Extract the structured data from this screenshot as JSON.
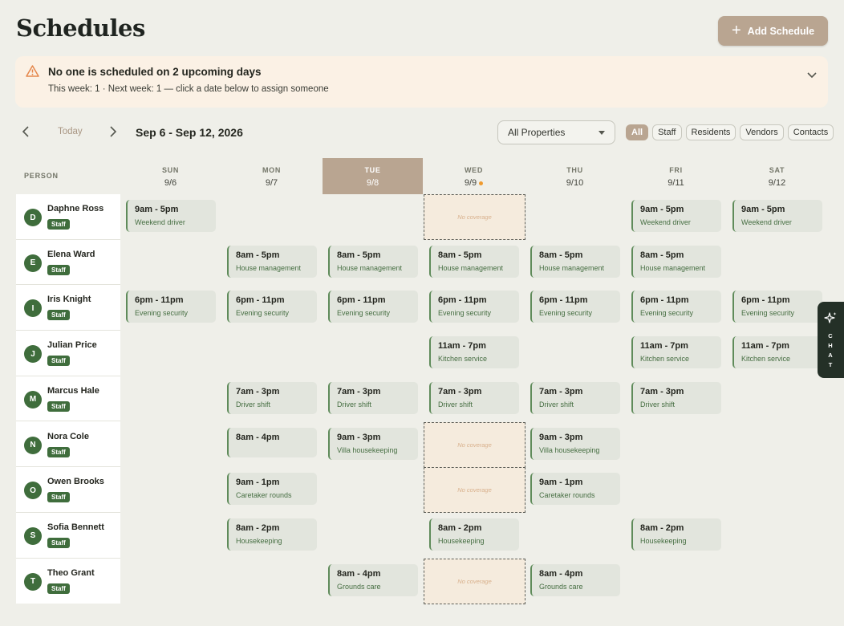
{
  "header": {
    "title": "Schedules",
    "add_button": "Add Schedule"
  },
  "alert": {
    "title": "No one is scheduled on 2 upcoming days",
    "subtitle": "This week: 1 · Next week: 1 — click a date below to assign someone"
  },
  "toolbar": {
    "today": "Today",
    "range": "Sep 6 - Sep 12, 2026",
    "property_select": "All Properties",
    "filters": [
      "All",
      "Staff",
      "Residents",
      "Vendors",
      "Contacts"
    ],
    "active_filter": "All"
  },
  "grid": {
    "person_header": "PERSON",
    "days": [
      {
        "name": "SUN",
        "date": "9/6"
      },
      {
        "name": "MON",
        "date": "9/7"
      },
      {
        "name": "TUE",
        "date": "9/8"
      },
      {
        "name": "WED",
        "date": "9/9"
      },
      {
        "name": "THU",
        "date": "9/10"
      },
      {
        "name": "FRI",
        "date": "9/11"
      },
      {
        "name": "SAT",
        "date": "9/12"
      }
    ],
    "today_index": 2,
    "no_coverage_label": "No coverage",
    "people": [
      {
        "name": "Daphne Ross",
        "initial": "D",
        "badge": "Staff",
        "shifts": [
          {
            "day": 0,
            "time": "9am - 5pm",
            "role": "Weekend driver"
          },
          {
            "day": 3,
            "nocov": true
          },
          {
            "day": 5,
            "time": "9am - 5pm",
            "role": "Weekend driver"
          },
          {
            "day": 6,
            "time": "9am - 5pm",
            "role": "Weekend driver"
          }
        ]
      },
      {
        "name": "Elena Ward",
        "initial": "E",
        "badge": "Staff",
        "shifts": [
          {
            "day": 1,
            "time": "8am - 5pm",
            "role": "House management"
          },
          {
            "day": 2,
            "time": "8am - 5pm",
            "role": "House management"
          },
          {
            "day": 3,
            "time": "8am - 5pm",
            "role": "House management"
          },
          {
            "day": 4,
            "time": "8am - 5pm",
            "role": "House management"
          },
          {
            "day": 5,
            "time": "8am - 5pm",
            "role": "House management"
          }
        ]
      },
      {
        "name": "Iris Knight",
        "initial": "I",
        "badge": "Staff",
        "shifts": [
          {
            "day": 0,
            "time": "6pm - 11pm",
            "role": "Evening security"
          },
          {
            "day": 1,
            "time": "6pm - 11pm",
            "role": "Evening security"
          },
          {
            "day": 2,
            "time": "6pm - 11pm",
            "role": "Evening security"
          },
          {
            "day": 3,
            "time": "6pm - 11pm",
            "role": "Evening security"
          },
          {
            "day": 4,
            "time": "6pm - 11pm",
            "role": "Evening security"
          },
          {
            "day": 5,
            "time": "6pm - 11pm",
            "role": "Evening security"
          },
          {
            "day": 6,
            "time": "6pm - 11pm",
            "role": "Evening security"
          }
        ]
      },
      {
        "name": "Julian Price",
        "initial": "J",
        "badge": "Staff",
        "shifts": [
          {
            "day": 3,
            "time": "11am - 7pm",
            "role": "Kitchen service"
          },
          {
            "day": 5,
            "time": "11am - 7pm",
            "role": "Kitchen service"
          },
          {
            "day": 6,
            "time": "11am - 7pm",
            "role": "Kitchen service"
          }
        ]
      },
      {
        "name": "Marcus Hale",
        "initial": "M",
        "badge": "Staff",
        "shifts": [
          {
            "day": 1,
            "time": "7am - 3pm",
            "role": "Driver shift"
          },
          {
            "day": 2,
            "time": "7am - 3pm",
            "role": "Driver shift"
          },
          {
            "day": 3,
            "time": "7am - 3pm",
            "role": "Driver shift"
          },
          {
            "day": 4,
            "time": "7am - 3pm",
            "role": "Driver shift"
          },
          {
            "day": 5,
            "time": "7am - 3pm",
            "role": "Driver shift"
          }
        ]
      },
      {
        "name": "Nora Cole",
        "initial": "N",
        "badge": "Staff",
        "shifts": [
          {
            "day": 1,
            "time": "8am - 4pm",
            "role": ""
          },
          {
            "day": 2,
            "time": "9am - 3pm",
            "role": "Villa housekeeping"
          },
          {
            "day": 3,
            "nocov": true
          },
          {
            "day": 4,
            "time": "9am - 3pm",
            "role": "Villa housekeeping"
          }
        ]
      },
      {
        "name": "Owen Brooks",
        "initial": "O",
        "badge": "Staff",
        "shifts": [
          {
            "day": 1,
            "time": "9am - 1pm",
            "role": "Caretaker rounds"
          },
          {
            "day": 3,
            "nocov": true
          },
          {
            "day": 4,
            "time": "9am - 1pm",
            "role": "Caretaker rounds"
          }
        ]
      },
      {
        "name": "Sofia Bennett",
        "initial": "S",
        "badge": "Staff",
        "shifts": [
          {
            "day": 1,
            "time": "8am - 2pm",
            "role": "Housekeeping"
          },
          {
            "day": 3,
            "time": "8am - 2pm",
            "role": "Housekeeping"
          },
          {
            "day": 5,
            "time": "8am - 2pm",
            "role": "Housekeeping"
          }
        ]
      },
      {
        "name": "Theo Grant",
        "initial": "T",
        "badge": "Staff",
        "shifts": [
          {
            "day": 2,
            "time": "8am - 4pm",
            "role": "Grounds care"
          },
          {
            "day": 3,
            "nocov": true
          },
          {
            "day": 4,
            "time": "8am - 4pm",
            "role": "Grounds care"
          }
        ]
      }
    ]
  },
  "chat": {
    "letters": [
      "C",
      "H",
      "A",
      "T"
    ]
  },
  "colors": {
    "accent": "#b9a591",
    "staff_green": "#3f6d3c",
    "alert_bg": "#fbf1e5",
    "warning": "#ef9a2e"
  }
}
